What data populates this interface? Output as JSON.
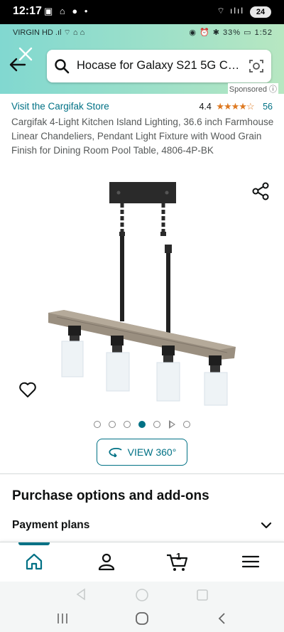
{
  "status_outer": {
    "time": "12:17",
    "left_icons": "▣ ⌂ ● •",
    "right_icons": "⌔ ılıl",
    "battery": "24"
  },
  "status_inner": {
    "carrier": "VIRGIN HD .ıl ⌔ ⌂ ⌂",
    "right": "◉ ⏰ ✱ 33% ▭ 1:52"
  },
  "search": {
    "query": "Hocase for Galaxy S21 5G Case..."
  },
  "sponsored": "Sponsored ⓘ",
  "product": {
    "store_link": "Visit the Cargifak Store",
    "rating_value": "4.4",
    "stars": "★★★★☆",
    "rating_count": "56",
    "title": "Cargifak 4-Light Kitchen Island Lighting, 36.6 inch Farmhouse Linear Chandeliers, Pendant Light Fixture with Wood Grain Finish for Dining Room Pool Table, 4806-4P-BK",
    "image_count": 7,
    "active_image_index": 3,
    "view360_label": "VIEW 360°"
  },
  "purchase": {
    "section_title": "Purchase options and add-ons",
    "payment_label": "Payment plans"
  },
  "bottom_nav": {
    "cart_count": "1",
    "items": [
      "home",
      "account",
      "cart",
      "menu"
    ]
  },
  "colors": {
    "accent": "#007185",
    "header_start": "#81d8d0",
    "header_end": "#b7e7c1",
    "star": "#de7921"
  }
}
